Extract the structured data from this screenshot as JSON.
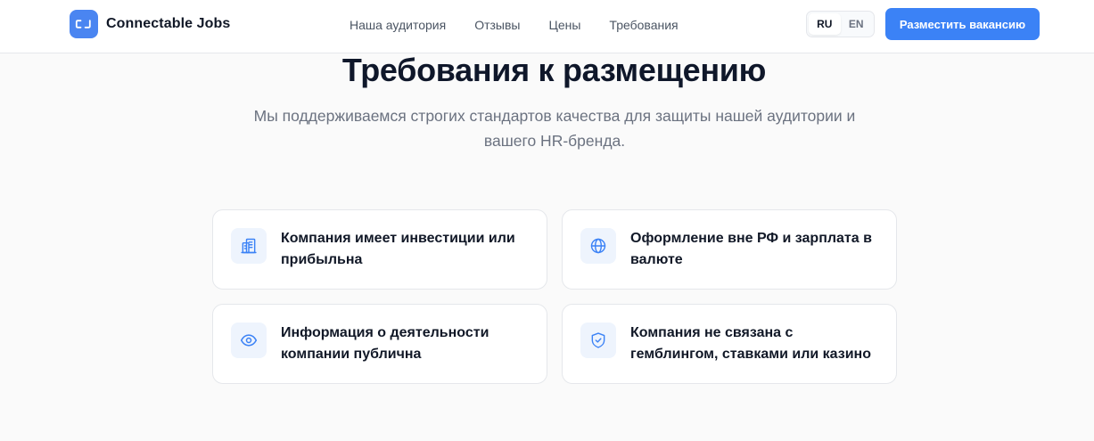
{
  "brand": {
    "logo_mark": "CJ",
    "name": "Connectable Jobs",
    "accent": "#3b82f6"
  },
  "nav": {
    "items": [
      {
        "label": "Наша аудитория"
      },
      {
        "label": "Отзывы"
      },
      {
        "label": "Цены"
      },
      {
        "label": "Требования"
      }
    ]
  },
  "language": {
    "options": [
      "RU",
      "EN"
    ],
    "selected": "RU"
  },
  "header": {
    "cta_label": "Разместить вакансию"
  },
  "section": {
    "title": "Требования к размещению",
    "subtitle": "Мы поддерживаемся строгих стандартов качества для защиты нашей аудитории и вашего HR-бренда.",
    "cards": [
      {
        "icon": "building-icon",
        "text": "Компания имеет инвестиции или прибыльна"
      },
      {
        "icon": "globe-icon",
        "text": "Оформление вне РФ и зарплата в валюте"
      },
      {
        "icon": "eye-icon",
        "text": "Информация о деятельности компании публична"
      },
      {
        "icon": "shield-check-icon",
        "text": "Компания не связана с гемблингом, ставками или казино"
      }
    ]
  }
}
